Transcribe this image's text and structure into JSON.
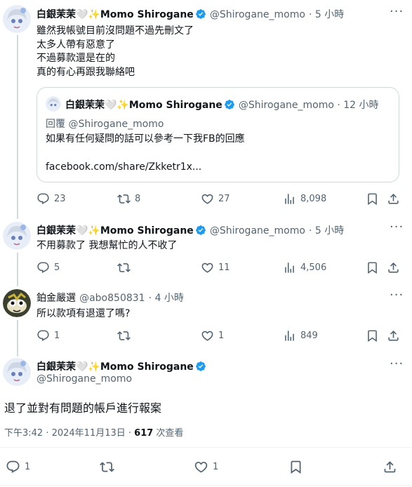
{
  "tweet1": {
    "name": "白銀茉茉🤍✨Momo Shirogane",
    "handle": "@Shirogane_momo",
    "time": "· 5 小時",
    "lines": [
      "雖然我帳號目前沒問題不過先刪文了",
      "太多人帶有惡意了",
      "不過募款還是在的",
      "真的有心再跟我聯絡吧"
    ],
    "quote": {
      "name": "白銀茉茉🤍✨Momo Shirogane",
      "handle": "@Shirogane_momo · 12 小時",
      "reply_to": "回覆 @Shirogane_momo",
      "text": "如果有任何疑問的話可以參考一下我FB的回應",
      "link": "facebook.com/share/Zkketr1x..."
    },
    "stats": {
      "replies": "23",
      "retweets": "8",
      "likes": "27",
      "views": "8,098"
    }
  },
  "tweet2": {
    "name": "白銀茉茉🤍✨Momo Shirogane",
    "handle": "@Shirogane_momo",
    "time": "· 5 小時",
    "text": "不用募款了 我想幫忙的人不收了",
    "stats": {
      "replies": "5",
      "retweets": "",
      "likes": "11",
      "views": "4,506"
    }
  },
  "tweet3": {
    "name": "鉑金嚴選",
    "handle": "@abo850831",
    "time": "· 4 小時",
    "text": "所以款項有退還了嗎?",
    "stats": {
      "replies": "1",
      "retweets": "",
      "likes": "1",
      "views": "849"
    }
  },
  "main": {
    "name": "白銀茉茉🤍✨Momo Shirogane",
    "handle": "@Shirogane_momo",
    "text": "退了並對有問題的帳戶進行報案",
    "timestamp": "下午3:42 · 2024年11月13日 · ",
    "views_count": "617",
    "views_label": " 次查看",
    "stats": {
      "replies": "1",
      "likes": "1"
    }
  },
  "colors": {
    "verified": "#1d9bf0",
    "muted": "#536471",
    "border": "#cfd9de"
  },
  "icons": [
    "more-icon",
    "verified-icon",
    "reply-icon",
    "retweet-icon",
    "like-icon",
    "views-icon",
    "bookmark-icon",
    "share-icon"
  ]
}
